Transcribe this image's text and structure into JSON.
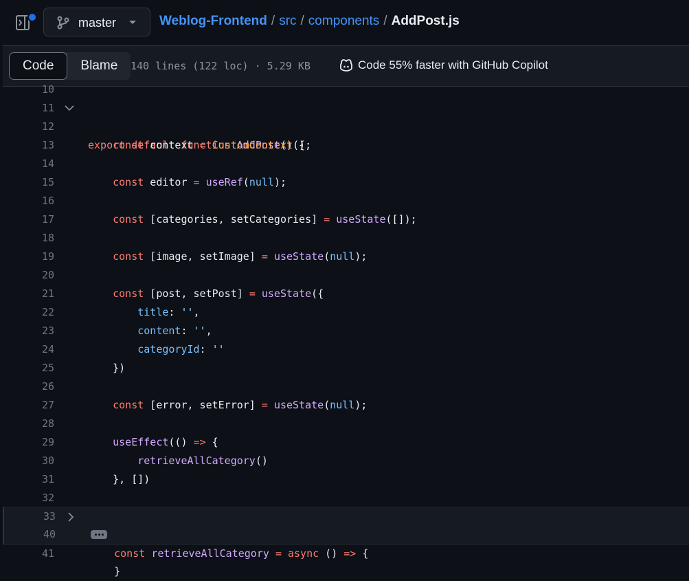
{
  "header": {
    "branch": "master",
    "crumbs": {
      "repo": "Weblog-Frontend",
      "dir1": "src",
      "dir2": "components",
      "file": "AddPost.js",
      "sep": "/"
    }
  },
  "toolbar": {
    "code_tab": "Code",
    "blame_tab": "Blame",
    "meta": "140 lines (122 loc) · 5.29 KB",
    "copilot": "Code 55% faster with GitHub Copilot"
  },
  "lines": [
    "10",
    "11",
    "12",
    "13",
    "14",
    "15",
    "16",
    "17",
    "18",
    "19",
    "20",
    "21",
    "22",
    "23",
    "24",
    "25",
    "26",
    "27",
    "28",
    "29",
    "30",
    "31",
    "32",
    "33",
    "40",
    "41"
  ],
  "colors": {
    "keyword": "#ff7b72",
    "function": "#d2a8ff",
    "constant": "#79c0ff",
    "string": "#a5d6ff",
    "link": "#4493f8",
    "bg": "#0d1117"
  },
  "icons": {
    "sidebar": "sidebar-expand-icon",
    "branch": "git-branch-icon",
    "copilot": "copilot-icon",
    "fold_open": "chevron-down-icon",
    "fold_closed": "chevron-right-icon",
    "collapsed": "ellipsis-icon"
  }
}
